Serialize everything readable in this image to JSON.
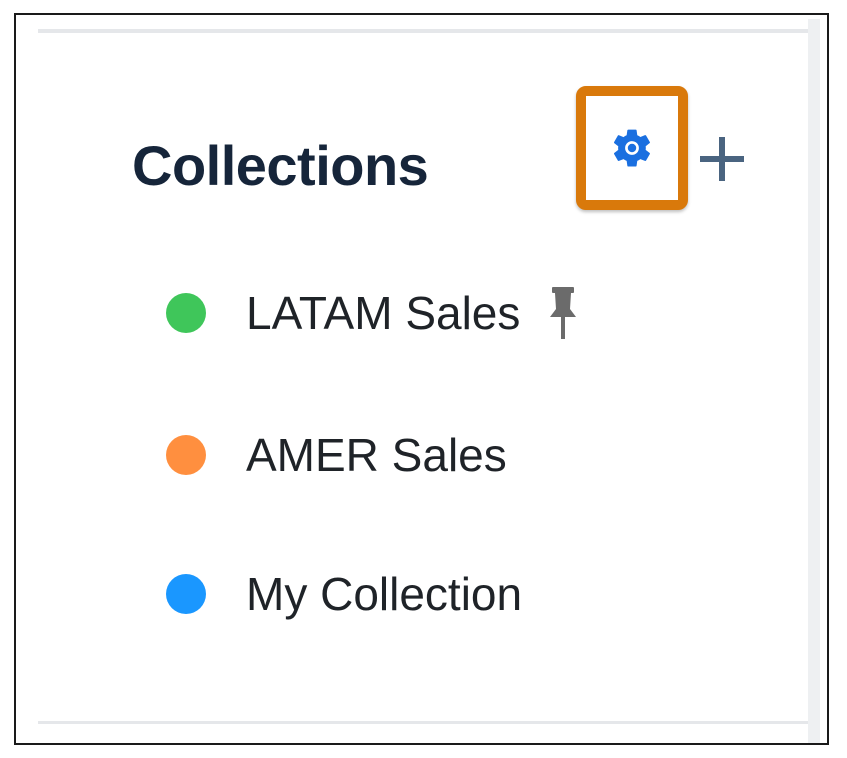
{
  "collections": {
    "title": "Collections",
    "settings_icon": "gear-icon",
    "add_icon": "plus-icon",
    "colors": {
      "title": "#16253a",
      "accent_highlight": "#d9790b",
      "gear": "#1a6fe0",
      "plus": "#4a6480"
    },
    "items": [
      {
        "label": "LATAM Sales",
        "color": "#3fc65a",
        "pinned": true
      },
      {
        "label": "AMER Sales",
        "color": "#ff8f3f",
        "pinned": false
      },
      {
        "label": "My Collection",
        "color": "#1a97ff",
        "pinned": false
      }
    ]
  }
}
